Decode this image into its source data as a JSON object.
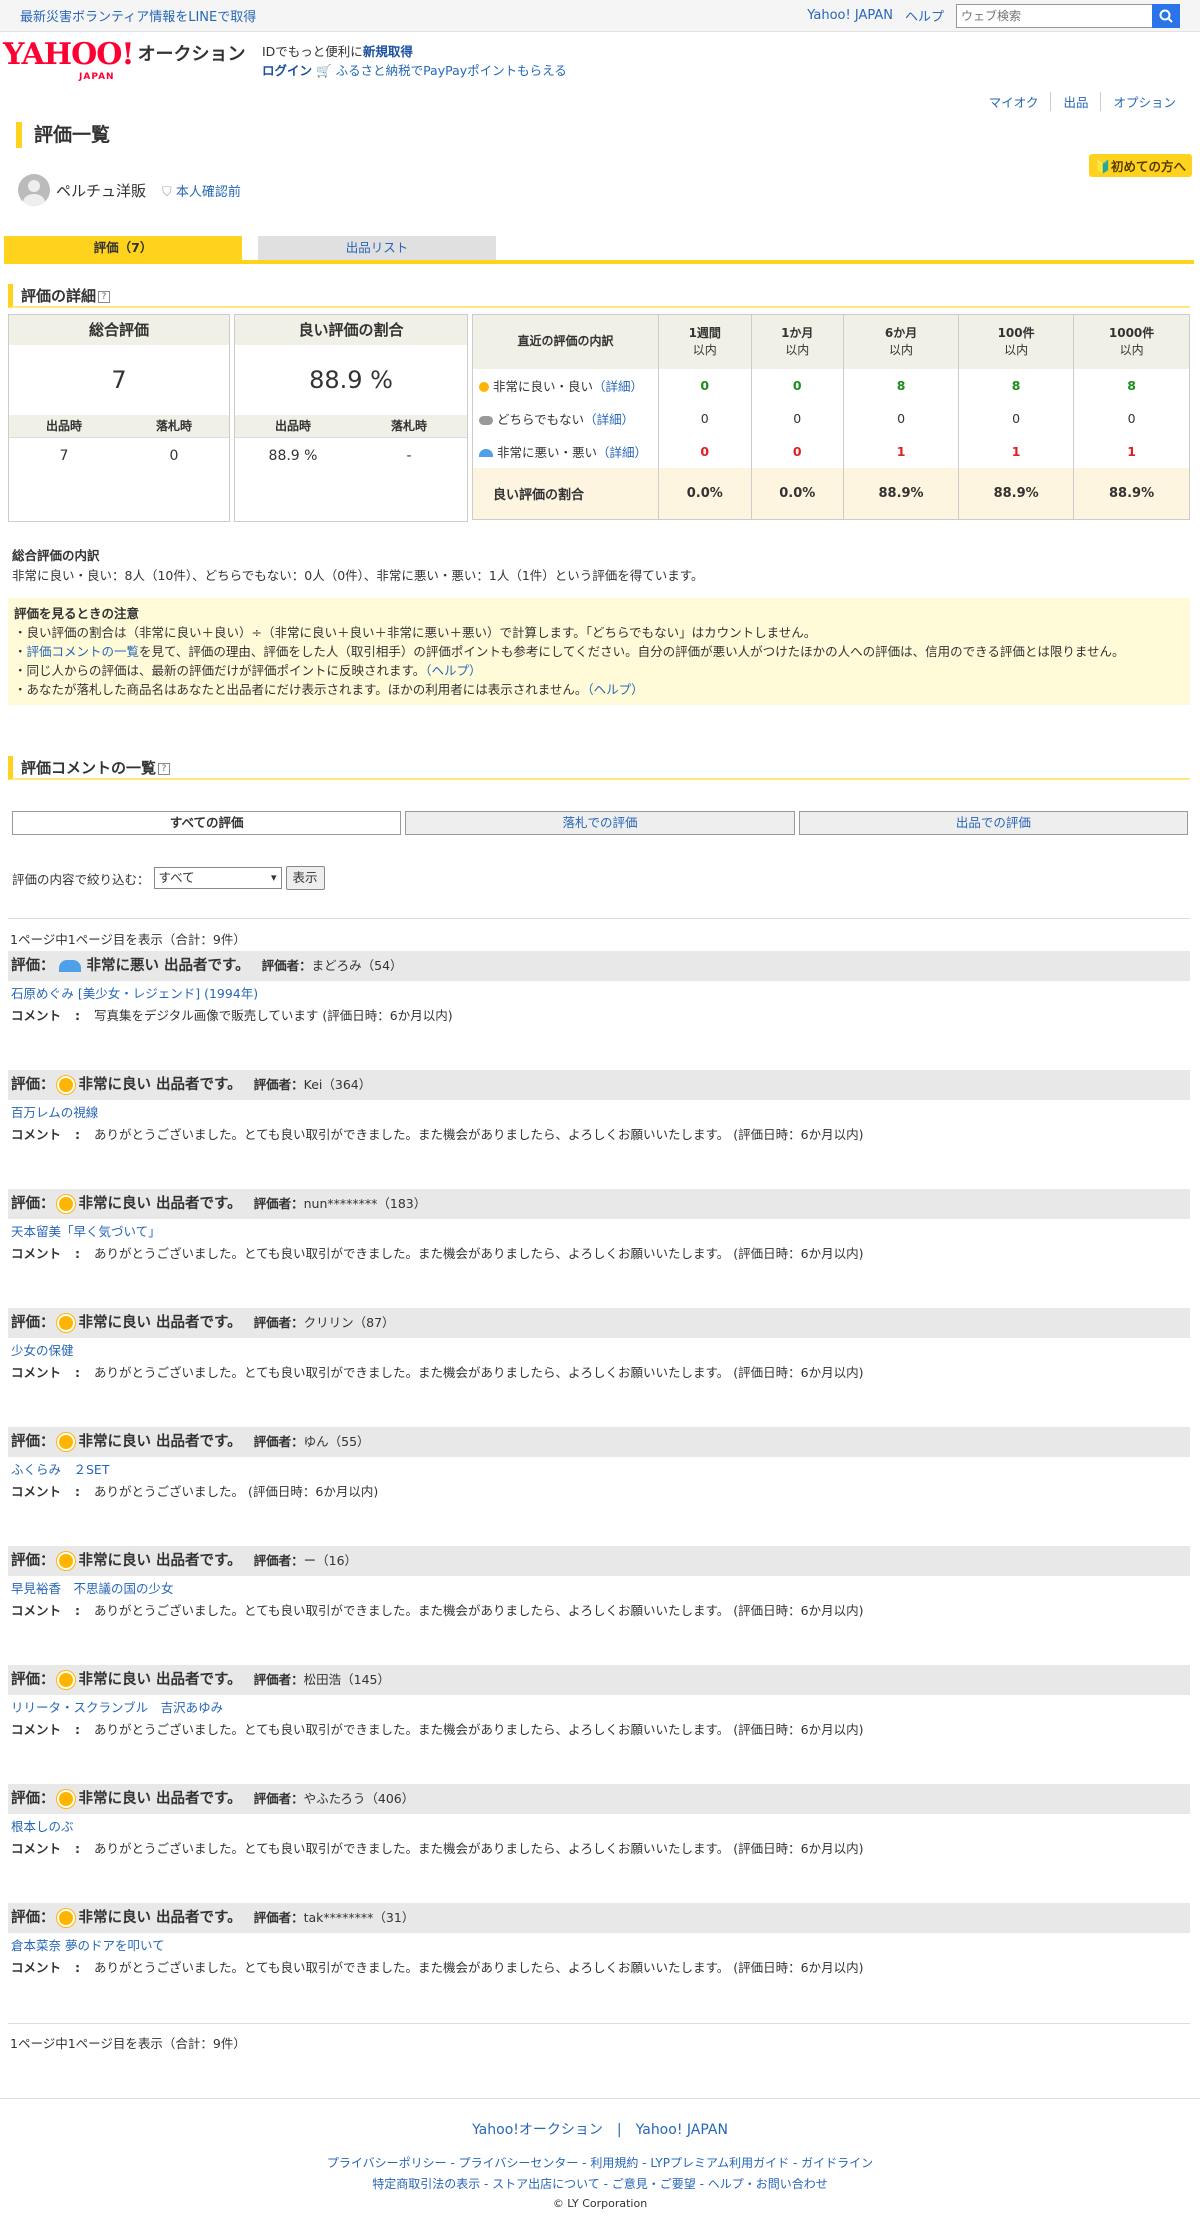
{
  "topbar": {
    "promo": "最新災害ボランティア情報をLINEで取得",
    "yahoo_japan": "Yahoo! JAPAN",
    "help": "ヘルプ",
    "search_placeholder": "ウェブ検索"
  },
  "header": {
    "logo_text": "YAHOO!",
    "logo_sub": "JAPAN",
    "service": "オークション",
    "id_text": "IDでもっと便利に",
    "register": "新規取得",
    "login": "ログイン",
    "furusato": "ふるさと納税でPayPayポイントもらえる"
  },
  "subnav": [
    "マイオク",
    "出品",
    "オプション"
  ],
  "page_title": "評価一覧",
  "first_time": "初めての方へ",
  "user": {
    "name": "ペルチュ洋販",
    "verify": "本人確認前"
  },
  "tabs": {
    "rating": "評価（7）",
    "listing": "出品リスト"
  },
  "details_title": "評価の詳細",
  "total": {
    "label": "総合評価",
    "value": "7",
    "seller_label": "出品時",
    "buyer_label": "落札時",
    "seller": "7",
    "buyer": "0"
  },
  "ratio": {
    "label": "良い評価の割合",
    "value": "88.9 %",
    "seller_label": "出品時",
    "buyer_label": "落札時",
    "seller": "88.9 %",
    "buyer": "-"
  },
  "recent": {
    "header": "直近の評価の内訳",
    "periods": [
      {
        "top": "1週間",
        "bottom": "以内"
      },
      {
        "top": "1か月",
        "bottom": "以内"
      },
      {
        "top": "6か月",
        "bottom": "以内"
      },
      {
        "top": "100件",
        "bottom": "以内"
      },
      {
        "top": "1000件",
        "bottom": "以内"
      }
    ],
    "rows": [
      {
        "label": "非常に良い・良い",
        "detail": "（詳細）",
        "icon": "sun-icon",
        "values": [
          "0",
          "0",
          "8",
          "8",
          "8"
        ]
      },
      {
        "label": "どちらでもない",
        "detail": "（詳細）",
        "icon": "cloud-icon",
        "values": [
          "0",
          "0",
          "0",
          "0",
          "0"
        ]
      },
      {
        "label": "非常に悪い・悪い",
        "detail": "（詳細）",
        "icon": "umbrella-icon",
        "values": [
          "0",
          "0",
          "1",
          "1",
          "1"
        ]
      }
    ],
    "footer_label": "良い評価の割合",
    "footer_values": [
      "0.0%",
      "0.0%",
      "88.9%",
      "88.9%",
      "88.9%"
    ]
  },
  "breakdown": {
    "title": "総合評価の内訳",
    "text": "非常に良い・良い：8人（10件）、どちらでもない：0人（0件）、非常に悪い・悪い：1人（1件）という評価を得ています。"
  },
  "caution": {
    "title": "評価を見るときの注意",
    "line1": "・良い評価の割合は（非常に良い＋良い）÷（非常に良い＋良い＋非常に悪い＋悪い）で計算します。「どちらでもない」はカウントしません。",
    "line2_link": "評価コメントの一覧",
    "line2_pre": "・",
    "line2": "を見て、評価の理由、評価をした人（取引相手）の評価ポイントも参考にしてください。自分の評価が悪い人がつけたほかの人への評価は、信用のできる評価とは限りません。",
    "line3": "・同じ人からの評価は、最新の評価だけが評価ポイントに反映されます。",
    "line4": "・あなたが落札した商品名はあなたと出品者にだけ表示されます。ほかの利用者には表示されません。",
    "help": "（ヘルプ）"
  },
  "comments_title": "評価コメントの一覧",
  "filters": [
    "すべての評価",
    "落札での評価",
    "出品での評価"
  ],
  "narrow": {
    "label": "評価の内容で絞り込む：",
    "selected": "すべて",
    "button": "表示"
  },
  "pager": {
    "text": "1ページ中1ページ目を表示（合計：9件）"
  },
  "reviews": [
    {
      "rating_label": "評価：",
      "icon": "umbrella-icon",
      "rating": "非常に悪い 出品者です。",
      "by_label": "評価者：",
      "by": "まどろみ（54）",
      "item": "石原めぐみ [美少女・レジェンド] (1994年)",
      "comment_label": "コメント",
      "comment": "写真集をデジタル画像で販売しています (評価日時：6か月以内)"
    },
    {
      "rating_label": "評価：",
      "icon": "sun-icon",
      "rating": "非常に良い 出品者です。",
      "by_label": "評価者：",
      "by": "Kei（364）",
      "item": "百万レムの視線",
      "comment_label": "コメント",
      "comment": "ありがとうございました。とても良い取引ができました。また機会がありましたら、よろしくお願いいたします。 (評価日時：6か月以内)"
    },
    {
      "rating_label": "評価：",
      "icon": "sun-icon",
      "rating": "非常に良い 出品者です。",
      "by_label": "評価者：",
      "by": "nun********（183）",
      "item": "天本留美「早く気づいて」",
      "comment_label": "コメント",
      "comment": "ありがとうございました。とても良い取引ができました。また機会がありましたら、よろしくお願いいたします。 (評価日時：6か月以内)"
    },
    {
      "rating_label": "評価：",
      "icon": "sun-icon",
      "rating": "非常に良い 出品者です。",
      "by_label": "評価者：",
      "by": "クリリン（87）",
      "item": "少女の保健",
      "comment_label": "コメント",
      "comment": "ありがとうございました。とても良い取引ができました。また機会がありましたら、よろしくお願いいたします。 (評価日時：6か月以内)"
    },
    {
      "rating_label": "評価：",
      "icon": "sun-icon",
      "rating": "非常に良い 出品者です。",
      "by_label": "評価者：",
      "by": "ゆん（55）",
      "item": "ふくらみ　２SET",
      "comment_label": "コメント",
      "comment": "ありがとうございました。 (評価日時：6か月以内)"
    },
    {
      "rating_label": "評価：",
      "icon": "sun-icon",
      "rating": "非常に良い 出品者です。",
      "by_label": "評価者：",
      "by": "ー（16）",
      "item": "早見裕香　不思議の国の少女",
      "comment_label": "コメント",
      "comment": "ありがとうございました。とても良い取引ができました。また機会がありましたら、よろしくお願いいたします。 (評価日時：6か月以内)"
    },
    {
      "rating_label": "評価：",
      "icon": "sun-icon",
      "rating": "非常に良い 出品者です。",
      "by_label": "評価者：",
      "by": "松田浩（145）",
      "item": "リリータ・スクランブル　吉沢あゆみ",
      "comment_label": "コメント",
      "comment": "ありがとうございました。とても良い取引ができました。また機会がありましたら、よろしくお願いいたします。 (評価日時：6か月以内)"
    },
    {
      "rating_label": "評価：",
      "icon": "sun-icon",
      "rating": "非常に良い 出品者です。",
      "by_label": "評価者：",
      "by": "やふたろう（406）",
      "item": "根本しのぶ",
      "comment_label": "コメント",
      "comment": "ありがとうございました。とても良い取引ができました。また機会がありましたら、よろしくお願いいたします。 (評価日時：6か月以内)"
    },
    {
      "rating_label": "評価：",
      "icon": "sun-icon",
      "rating": "非常に良い 出品者です。",
      "by_label": "評価者：",
      "by": "tak********（31）",
      "item": "倉本菜奈 夢のドアを叩いて",
      "comment_label": "コメント",
      "comment": "ありがとうございました。とても良い取引ができました。また機会がありましたら、よろしくお願いいたします。 (評価日時：6か月以内)"
    }
  ],
  "footer": {
    "main": [
      "Yahoo!オークション",
      "Yahoo! JAPAN"
    ],
    "links1": [
      "プライバシーポリシー",
      "プライバシーセンター",
      "利用規約",
      "LYPプレミアム利用ガイド",
      "ガイドライン"
    ],
    "links2": [
      "特定商取引法の表示",
      "ストア出店について",
      "ご意見・ご要望",
      "ヘルプ・お問い合わせ"
    ],
    "copyright": "© LY Corporation"
  },
  "colors": {
    "accent": "#ffd21e",
    "link": "#2767b8",
    "good": "#1e8c1e",
    "bad": "#dd2222",
    "brand": "#ff0033"
  }
}
